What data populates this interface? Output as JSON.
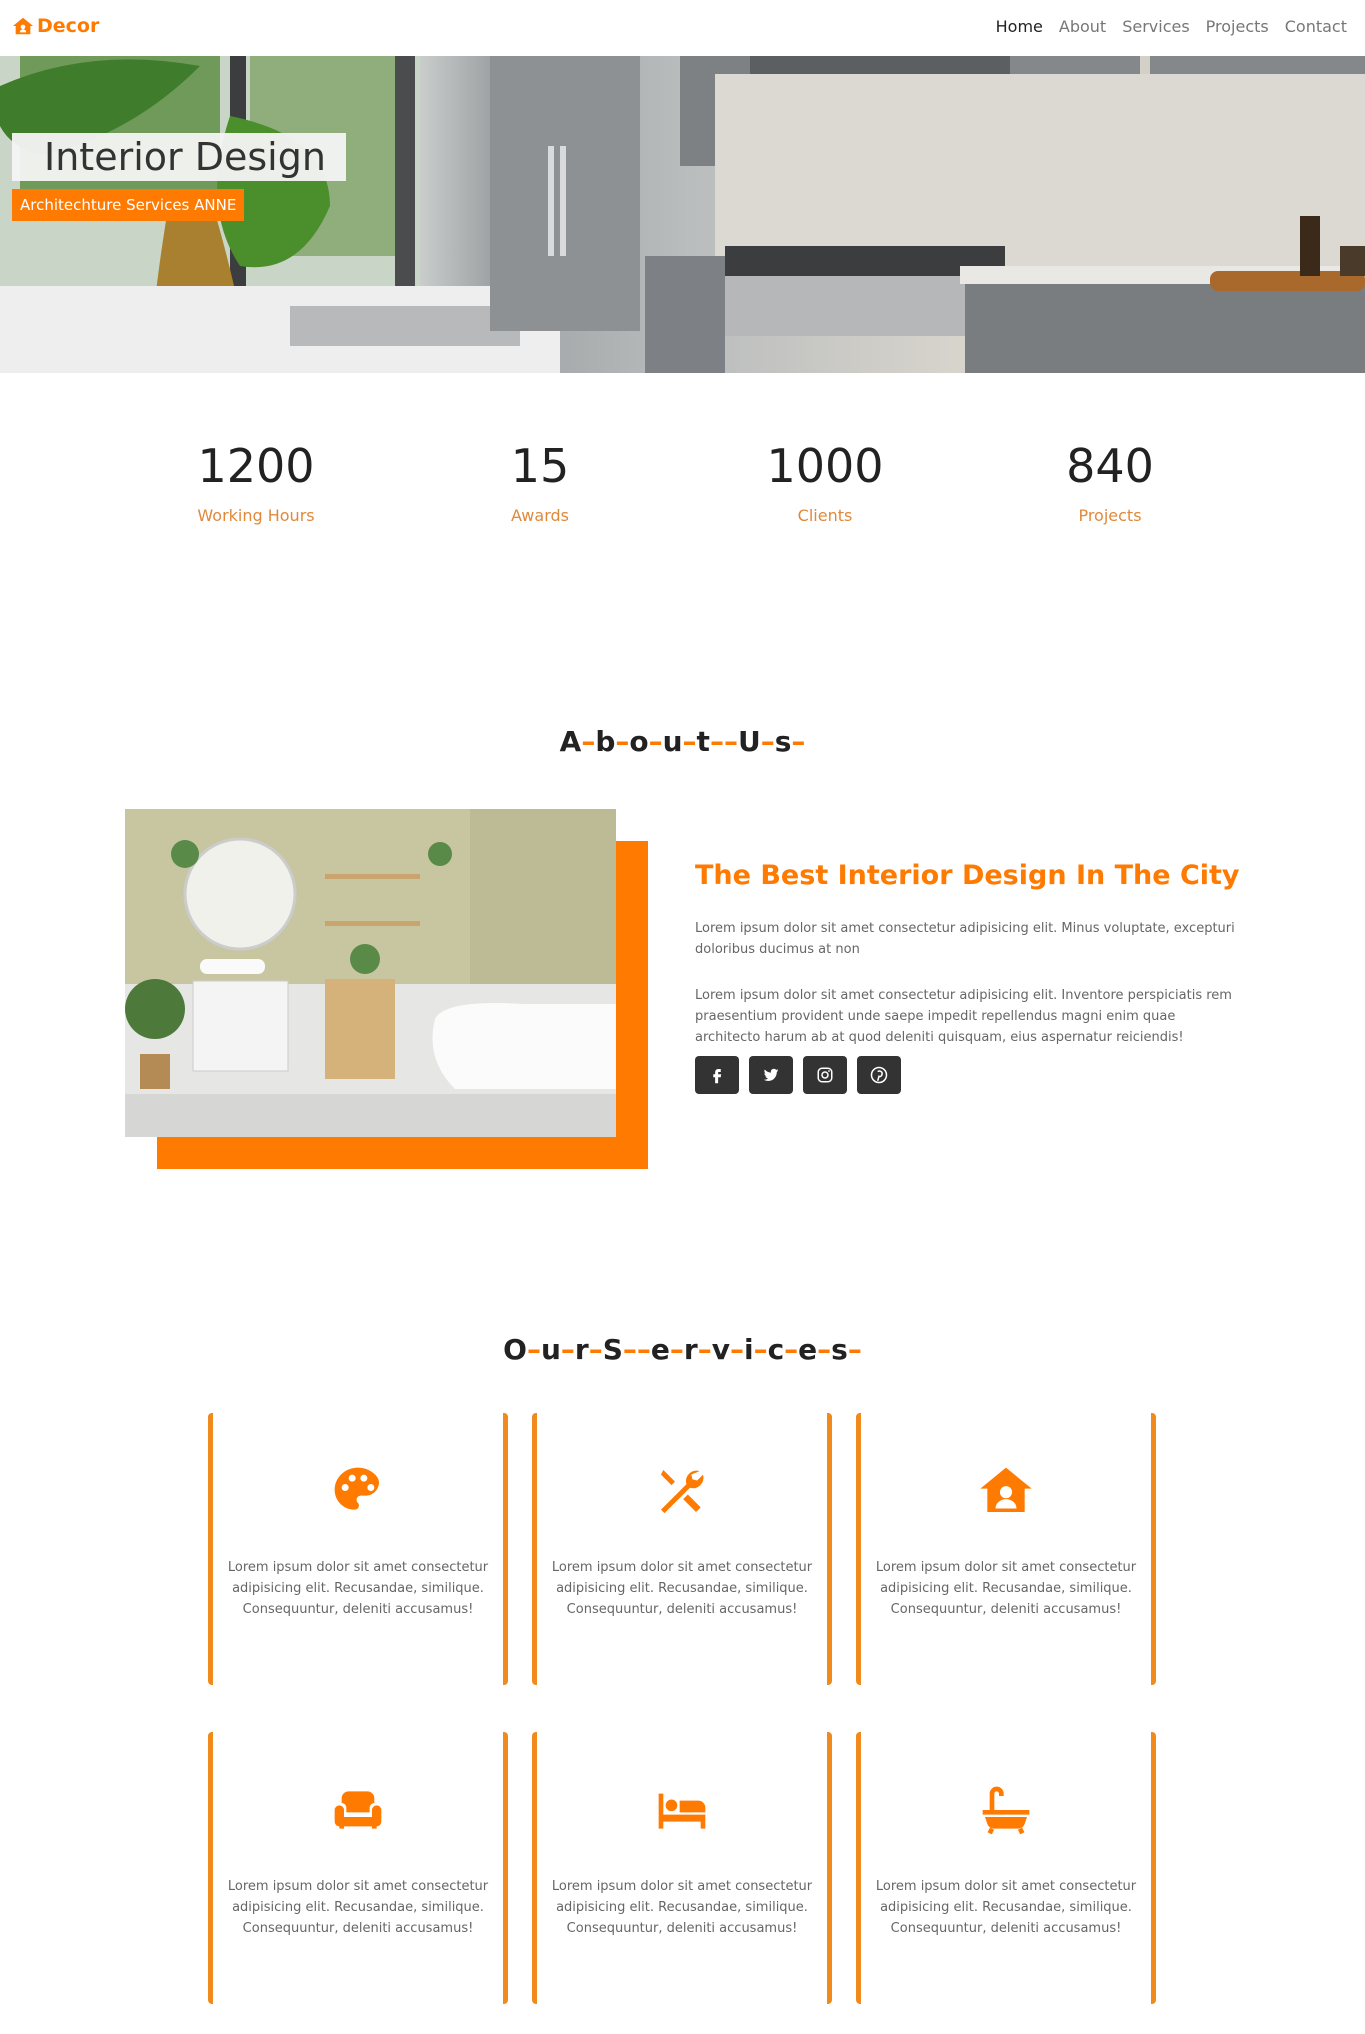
{
  "nav": {
    "brand": "Decor",
    "links": [
      "Home",
      "About",
      "Services",
      "Projects",
      "Contact"
    ]
  },
  "hero": {
    "title": "Interior Design",
    "subtitle": "Architechture Services ANNE"
  },
  "stats": [
    {
      "value": "1200",
      "label": "Working Hours"
    },
    {
      "value": "15",
      "label": "Awards"
    },
    {
      "value": "1000",
      "label": "Clients"
    },
    {
      "value": "840",
      "label": "Projects"
    }
  ],
  "about": {
    "section_title_letters": [
      "A",
      "b",
      "o",
      "u",
      "t",
      "",
      "U",
      "s"
    ],
    "heading": "The Best Interior Design In The City",
    "paragraph1": "Lorem ipsum dolor sit amet consectetur adipisicing elit. Minus voluptate, excepturi doloribus ducimus at non",
    "paragraph2": "Lorem ipsum dolor sit amet consectetur adipisicing elit. Inventore perspiciatis rem praesentium provident unde saepe impedit repellendus magni enim quae architecto harum ab at quod deleniti quisquam, eius aspernatur reiciendis!",
    "social_icons": [
      "facebook-icon",
      "twitter-icon",
      "instagram-icon",
      "pinterest-icon"
    ]
  },
  "services": {
    "section_title_letters": [
      "O",
      "u",
      "r",
      "S",
      "",
      "e",
      "r",
      "v",
      "i",
      "c",
      "e",
      "s"
    ],
    "items": [
      {
        "icon": "palette-icon",
        "text": "Lorem ipsum dolor sit amet consectetur adipisicing elit. Recusandae, similique. Consequuntur, deleniti accusamus!"
      },
      {
        "icon": "tools-icon",
        "text": "Lorem ipsum dolor sit amet consectetur adipisicing elit. Recusandae, similique. Consequuntur, deleniti accusamus!"
      },
      {
        "icon": "house-user-icon",
        "text": "Lorem ipsum dolor sit amet consectetur adipisicing elit. Recusandae, similique. Consequuntur, deleniti accusamus!"
      },
      {
        "icon": "couch-icon",
        "text": "Lorem ipsum dolor sit amet consectetur adipisicing elit. Recusandae, similique. Consequuntur, deleniti accusamus!"
      },
      {
        "icon": "bed-icon",
        "text": "Lorem ipsum dolor sit amet consectetur adipisicing elit. Recusandae, similique. Consequuntur, deleniti accusamus!"
      },
      {
        "icon": "bath-icon",
        "text": "Lorem ipsum dolor sit amet consectetur adipisicing elit. Recusandae, similique. Consequuntur, deleniti accusamus!"
      }
    ]
  },
  "colors": {
    "accent": "#ff7a00",
    "dark": "#333333",
    "muted": "#666666"
  }
}
